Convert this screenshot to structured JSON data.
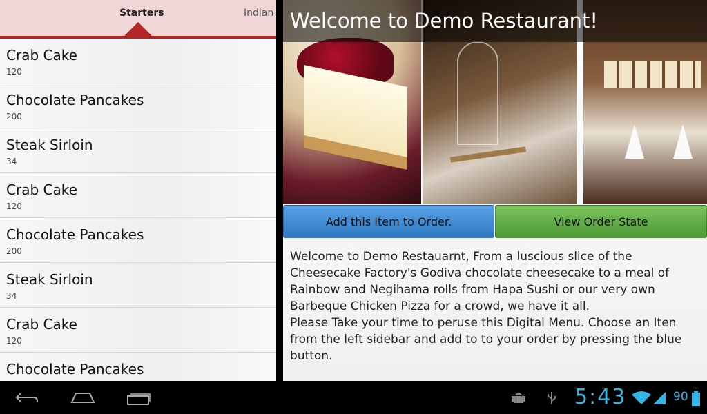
{
  "tabs": {
    "active": "Starters",
    "next": "Indian"
  },
  "menu_items": [
    {
      "name": "Crab Cake",
      "price": "120"
    },
    {
      "name": "Chocolate Pancakes",
      "price": "200"
    },
    {
      "name": "Steak Sirloin",
      "price": "34"
    },
    {
      "name": "Crab Cake",
      "price": "120"
    },
    {
      "name": "Chocolate Pancakes",
      "price": "200"
    },
    {
      "name": "Steak Sirloin",
      "price": "34"
    },
    {
      "name": "Crab Cake",
      "price": "120"
    },
    {
      "name": "Chocolate Pancakes",
      "price": ""
    }
  ],
  "detail": {
    "title": "Welcome to Demo Restaurant!",
    "add_button": "Add this Item to Order.",
    "view_button": "View Order State",
    "description": " Welcome to Demo Restauarnt, From a luscious slice of the Cheesecake Factory's Godiva chocolate cheesecake to a meal of Rainbow and Negihama rolls from Hapa Sushi or our very own Barbeque Chicken Pizza for a crowd, we have it all.\nPlease Take your time to peruse this Digital Menu. Choose an Iten from the left sidebar and add to to your order by pressing the blue button."
  },
  "system_bar": {
    "time": "5:43",
    "battery": "90",
    "accent_color": "#33b5e5"
  },
  "colors": {
    "tab_accent": "#b3262a",
    "add_button": "#2e78c4",
    "view_button": "#4d9a36"
  }
}
